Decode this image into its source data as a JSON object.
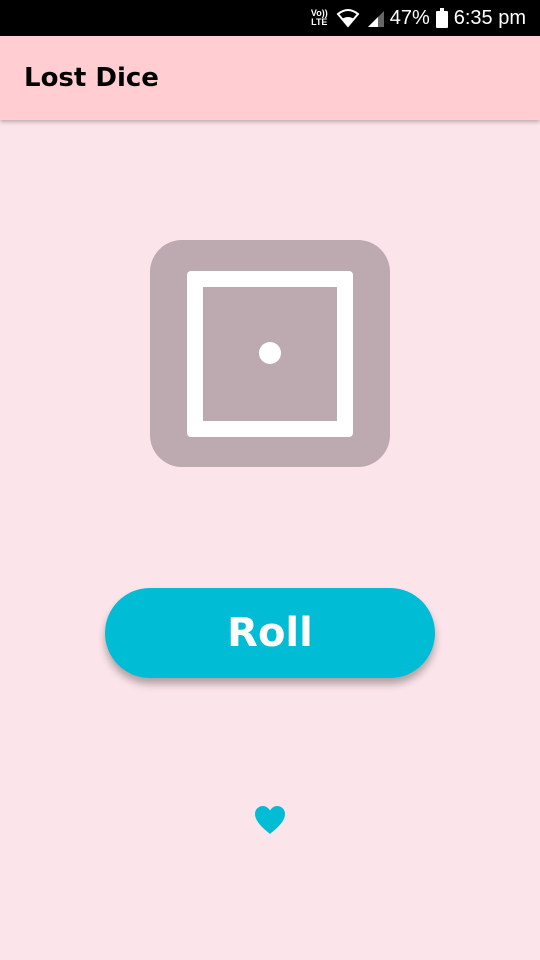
{
  "status_bar": {
    "volte_line1": "Vo))",
    "volte_line2": "LTE",
    "battery": "47%",
    "time": "6:35 pm",
    "icons": [
      "wifi-icon",
      "signal-icon",
      "battery-icon"
    ]
  },
  "app_bar": {
    "title": "Lost Dice"
  },
  "dice": {
    "face_value": 1
  },
  "roll_button": {
    "label": "Roll"
  },
  "heart": {
    "icon": "heart-icon"
  },
  "colors": {
    "background": "#fbe4ea",
    "app_bar": "#ffcdd2",
    "dice": "#bdaab0",
    "accent": "#00bcd4"
  }
}
